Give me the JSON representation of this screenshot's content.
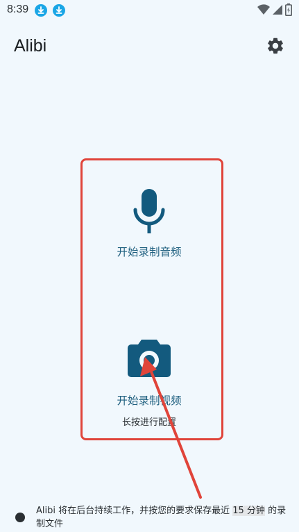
{
  "status_bar": {
    "time": "8:39",
    "icons": [
      "download-icon",
      "download-icon",
      "wifi-icon",
      "signal-icon",
      "battery-icon"
    ]
  },
  "app_bar": {
    "title": "Alibi",
    "settings_icon": "gear-icon"
  },
  "audio": {
    "label": "开始录制音频",
    "icon": "microphone-icon"
  },
  "video": {
    "label": "开始录制视频",
    "hint": "长按进行配置",
    "icon": "camera-icon"
  },
  "footer": {
    "text_before": "Alibi 将在后台持续工作，并按您的要求保存最近 ",
    "duration": "15 分钟",
    "text_after": " 的录制文件"
  },
  "colors": {
    "background": "#f1f8fd",
    "accent": "#1e5f7f",
    "icon": "#135a7e",
    "highlight": "#e0443a",
    "download_badge": "#1aa6e6"
  }
}
